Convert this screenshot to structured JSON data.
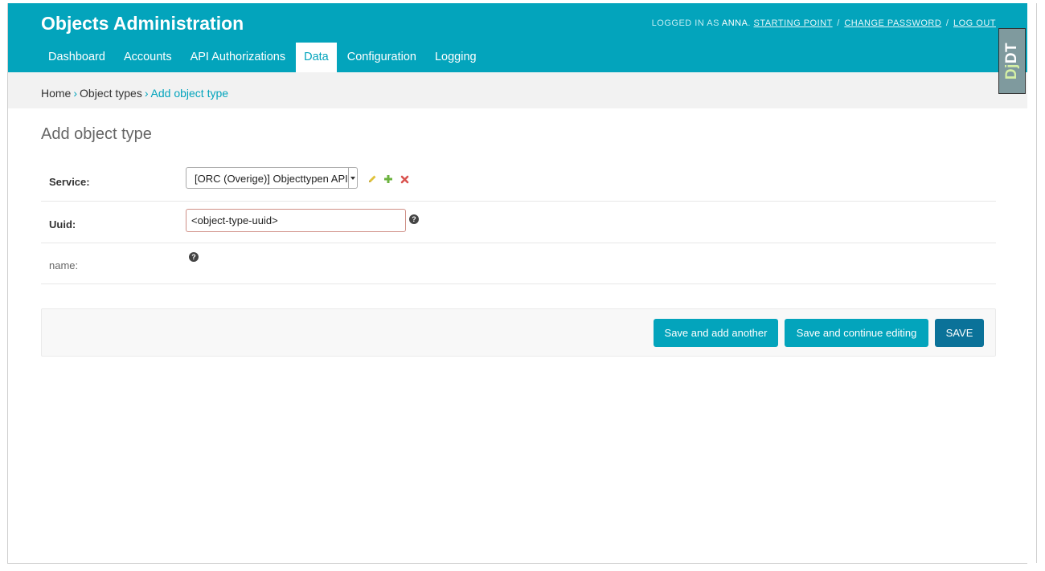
{
  "header": {
    "site_title": "Objects Administration",
    "usertools": {
      "logged_in_prefix": "LOGGED IN AS",
      "username": "ANNA",
      "period": ".",
      "links": [
        "STARTING POINT",
        "CHANGE PASSWORD",
        "LOG OUT"
      ],
      "separator": "/"
    }
  },
  "nav": {
    "tabs": [
      {
        "label": "Dashboard"
      },
      {
        "label": "Accounts"
      },
      {
        "label": "API Authorizations"
      },
      {
        "label": "Data",
        "active": true
      },
      {
        "label": "Configuration"
      },
      {
        "label": "Logging"
      }
    ]
  },
  "breadcrumbs": {
    "home": "Home",
    "sep": "›",
    "object_types": "Object types",
    "current": "Add object type"
  },
  "page_title": "Add object type",
  "form": {
    "service": {
      "label": "Service:",
      "selected": "[ORC (Overige)] Objecttypen API",
      "icons": [
        "pencil-icon",
        "plus-icon",
        "delete-icon"
      ]
    },
    "uuid": {
      "label": "Uuid:",
      "value": "<object-type-uuid>"
    },
    "name": {
      "label": "name:"
    }
  },
  "submit": {
    "save_add_another": "Save and add another",
    "save_continue": "Save and continue editing",
    "save": "SAVE"
  },
  "debug_toolbar": {
    "prefix": "Dj",
    "label": "DT"
  },
  "colors": {
    "brand": "#03a4bc",
    "save_default": "#0b7299",
    "pencil": "#e0c23a",
    "plus": "#6cb33f",
    "delete": "#d9534f"
  }
}
